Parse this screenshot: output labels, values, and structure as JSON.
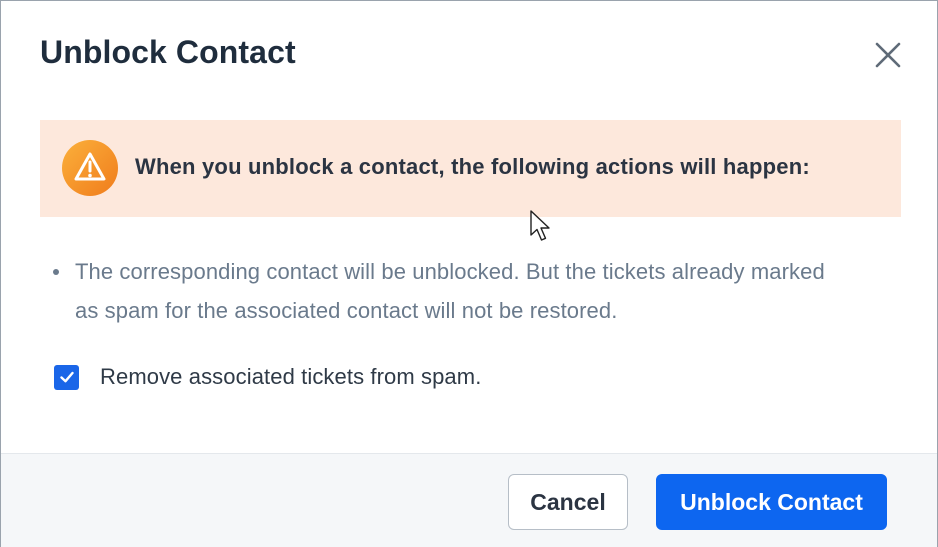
{
  "dialog": {
    "title": "Unblock Contact",
    "close_icon": "close-icon"
  },
  "warning": {
    "icon": "warning-icon",
    "text": "When you unblock a contact, the following actions will happen:",
    "background": "#fde8dc",
    "icon_color": "#f59a23"
  },
  "bullets": [
    {
      "text": "The corresponding contact will be unblocked. But the tickets already marked as spam for the associated contact will not be restored."
    }
  ],
  "option": {
    "label": "Remove associated tickets from spam.",
    "checked": true,
    "checkbox_color": "#1a66e8"
  },
  "footer": {
    "cancel_label": "Cancel",
    "confirm_label": "Unblock Contact",
    "primary_color": "#0d66f0"
  }
}
